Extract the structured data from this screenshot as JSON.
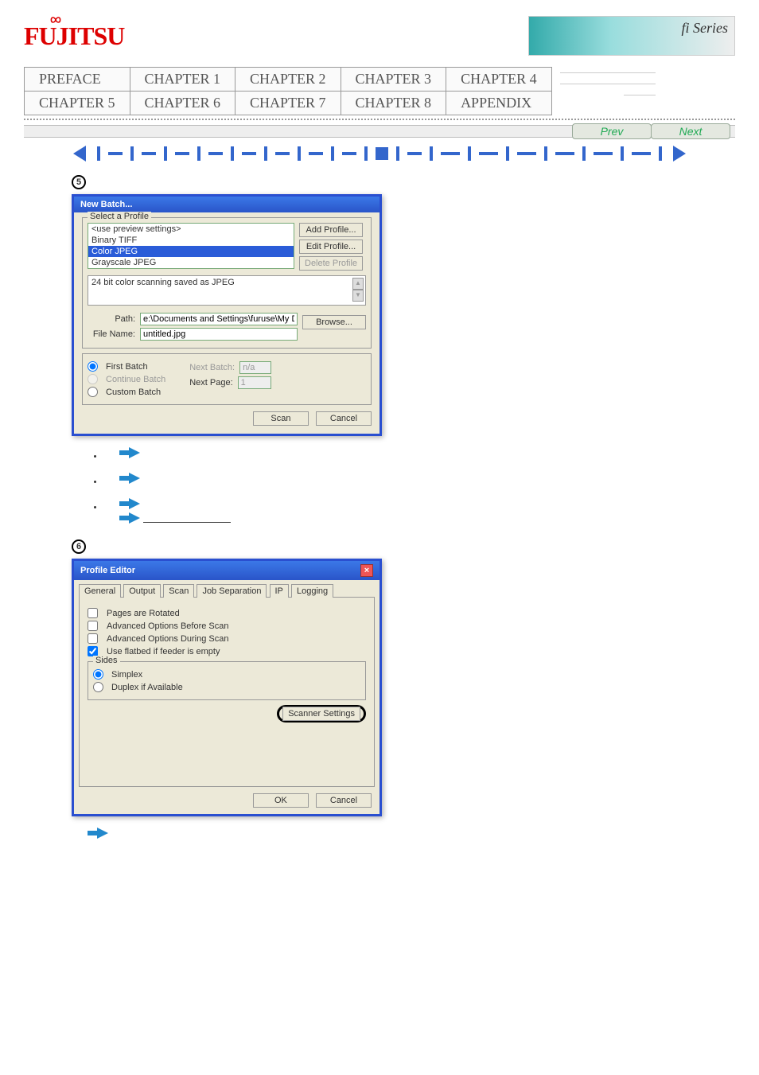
{
  "header": {
    "logo_text": "FUJITSU",
    "banner_text": "fi Series"
  },
  "nav": {
    "row1": [
      "PREFACE",
      "CHAPTER 1",
      "CHAPTER 2",
      "CHAPTER 3",
      "CHAPTER 4"
    ],
    "row2": [
      "CHAPTER 5",
      "CHAPTER 6",
      "CHAPTER 7",
      "CHAPTER 8",
      "APPENDIX"
    ]
  },
  "pager": {
    "prev": "Prev",
    "next": "Next"
  },
  "step5": {
    "num": "5",
    "dialog": {
      "title": "New Batch...",
      "group_label": "Select a Profile",
      "profiles": [
        "<use preview settings>",
        "Binary TIFF",
        "Color JPEG",
        "Grayscale JPEG"
      ],
      "selected_index": 2,
      "add": "Add Profile...",
      "edit": "Edit Profile...",
      "delete": "Delete Profile",
      "desc": "24 bit color scanning saved as JPEG",
      "path_label": "Path:",
      "path_value": "e:\\Documents and Settings\\furuse\\My Documents",
      "file_label": "File Name:",
      "file_value": "untitled.jpg",
      "browse": "Browse...",
      "first": "First Batch",
      "continue": "Continue Batch",
      "custom": "Custom Batch",
      "nextbatch_label": "Next Batch:",
      "nextbatch_value": "n/a",
      "nextpage_label": "Next Page:",
      "nextpage_value": "1",
      "scan": "Scan",
      "cancel": "Cancel"
    }
  },
  "step6": {
    "num": "6",
    "dialog": {
      "title": "Profile Editor",
      "tabs": [
        "General",
        "Output",
        "Scan",
        "Job Separation",
        "IP",
        "Logging"
      ],
      "active_tab": 2,
      "rotated": "Pages are Rotated",
      "before": "Advanced Options Before Scan",
      "during": "Advanced Options During Scan",
      "flatbed": "Use flatbed if feeder is empty",
      "sides_label": "Sides",
      "simplex": "Simplex",
      "duplex": "Duplex if Available",
      "scanner": "Scanner Settings",
      "ok": "OK",
      "cancel": "Cancel"
    }
  }
}
